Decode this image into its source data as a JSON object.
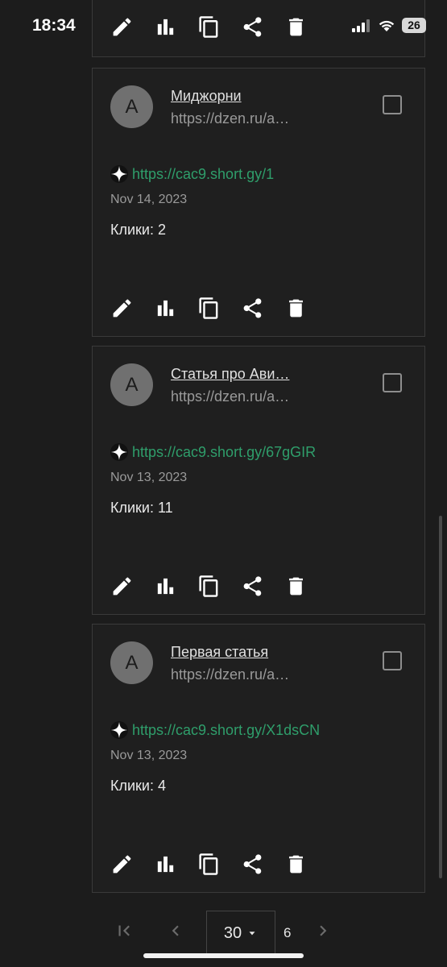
{
  "status_bar": {
    "time": "18:34",
    "battery": "26"
  },
  "cards": [
    {
      "title": "Миджорни",
      "url": "https://dzen.ru/a…",
      "avatar": "A",
      "short_link": "https://cac9.short.gy/1",
      "date": "Nov 14, 2023",
      "clicks": "Клики: 2"
    },
    {
      "title": "Статья про Ави…",
      "url": "https://dzen.ru/a…",
      "avatar": "A",
      "short_link": "https://cac9.short.gy/67gGIR",
      "date": "Nov 13, 2023",
      "clicks": "Клики: 11"
    },
    {
      "title": "Первая статья",
      "url": "https://dzen.ru/a…",
      "avatar": "A",
      "short_link": "https://cac9.short.gy/X1dsCN",
      "date": "Nov 13, 2023",
      "clicks": "Клики: 4"
    }
  ],
  "action_icons": [
    "edit-icon",
    "bar-chart-icon",
    "copy-icon",
    "share-icon",
    "delete-icon"
  ],
  "pagination": {
    "per_page": "30",
    "page": "6"
  },
  "colors": {
    "background": "#1c1c1c",
    "link": "#2f9e6b",
    "card_border": "#3a3a3a"
  }
}
